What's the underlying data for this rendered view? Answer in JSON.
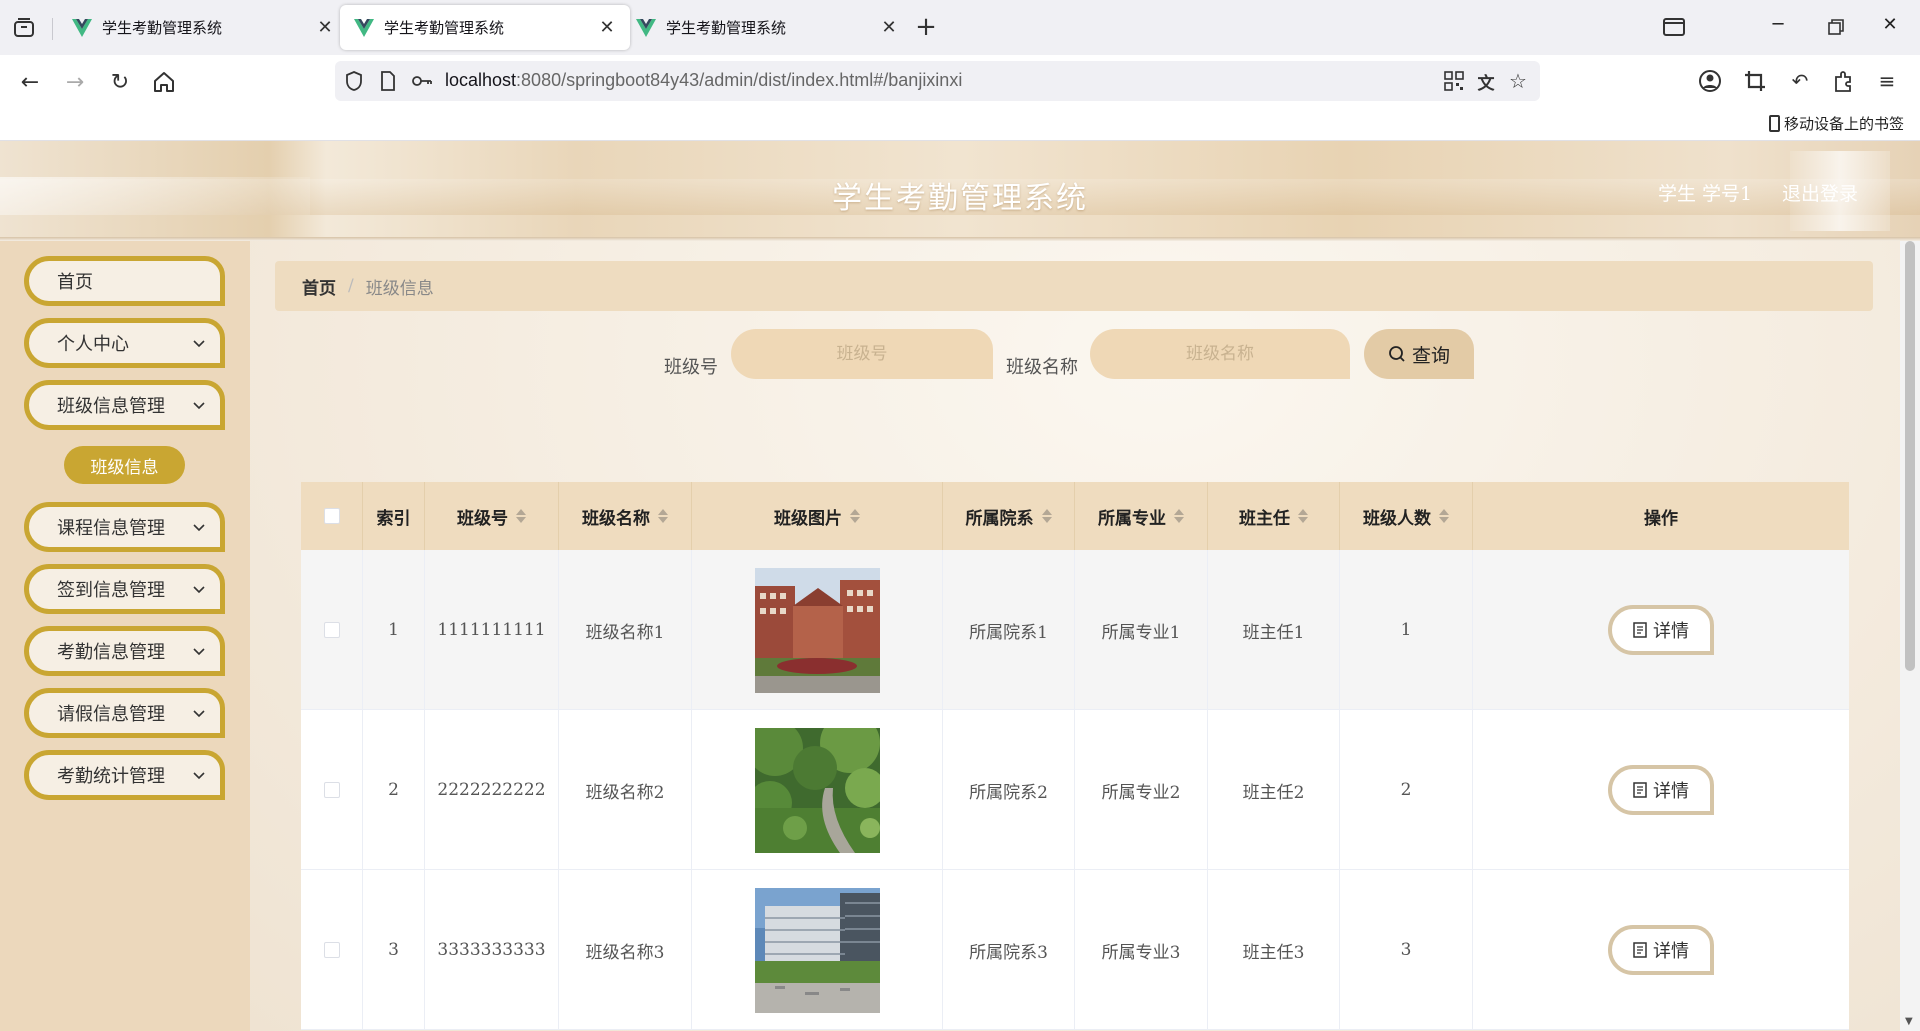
{
  "browser": {
    "tabs": [
      {
        "title": "学生考勤管理系统",
        "active": false
      },
      {
        "title": "学生考勤管理系统",
        "active": true
      },
      {
        "title": "学生考勤管理系统",
        "active": false
      }
    ],
    "url_host": "localhost",
    "url_rest": ":8080/springboot84y43/admin/dist/index.html#/banjixinxi",
    "bookmark": "移动设备上的书签"
  },
  "header": {
    "title": "学生考勤管理系统",
    "user": "学生 学号1",
    "logout": "退出登录"
  },
  "sidebar": {
    "items": [
      {
        "label": "首页",
        "expandable": false
      },
      {
        "label": "个人中心",
        "expandable": true
      },
      {
        "label": "班级信息管理",
        "expandable": true
      },
      {
        "label": "课程信息管理",
        "expandable": true
      },
      {
        "label": "签到信息管理",
        "expandable": true
      },
      {
        "label": "考勤信息管理",
        "expandable": true
      },
      {
        "label": "请假信息管理",
        "expandable": true
      },
      {
        "label": "考勤统计管理",
        "expandable": true
      }
    ],
    "active_sub": "班级信息"
  },
  "breadcrumb": {
    "home": "首页",
    "separator": "/",
    "current": "班级信息"
  },
  "search": {
    "class_no_label": "班级号",
    "class_no_placeholder": "班级号",
    "class_name_label": "班级名称",
    "class_name_placeholder": "班级名称",
    "button": "查询"
  },
  "table": {
    "headers": [
      "索引",
      "班级号",
      "班级名称",
      "班级图片",
      "所属院系",
      "所属专业",
      "班主任",
      "班级人数",
      "操作"
    ],
    "rows": [
      {
        "index": "1",
        "class_no": "1111111111",
        "class_name": "班级名称1",
        "photo": "campus-building-photo",
        "department": "所属院系1",
        "major": "所属专业1",
        "teacher": "班主任1",
        "count": "1",
        "action": "详情"
      },
      {
        "index": "2",
        "class_no": "2222222222",
        "class_name": "班级名称2",
        "photo": "campus-garden-path-photo",
        "department": "所属院系2",
        "major": "所属专业2",
        "teacher": "班主任2",
        "count": "2",
        "action": "详情"
      },
      {
        "index": "3",
        "class_no": "3333333333",
        "class_name": "班级名称3",
        "photo": "campus-modern-building-photo",
        "department": "所属院系3",
        "major": "所属专业3",
        "teacher": "班主任3",
        "count": "3",
        "action": "详情"
      }
    ]
  },
  "colors": {
    "accent_gold": "#c9a632",
    "sidebar_bg": "#ecd8bc",
    "header_row_bg": "#efdcbf"
  }
}
